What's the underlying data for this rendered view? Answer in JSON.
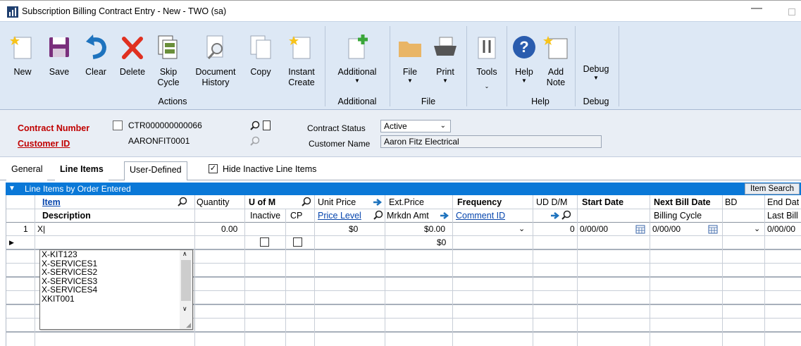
{
  "window": {
    "title": "Subscription Billing Contract Entry  -  New  -  TWO (sa)",
    "minimize": "—"
  },
  "ribbon": {
    "buttons": [
      {
        "label": "New"
      },
      {
        "label": "Save"
      },
      {
        "label": "Clear"
      },
      {
        "label": "Delete"
      },
      {
        "label": "Skip\nCycle"
      },
      {
        "label": "Document\nHistory"
      },
      {
        "label": "Copy"
      },
      {
        "label": "Instant\nCreate"
      },
      {
        "label": "Additional"
      },
      {
        "label": "File"
      },
      {
        "label": "Print"
      },
      {
        "label": "Tools"
      },
      {
        "label": "Help"
      },
      {
        "label": "Add\nNote"
      },
      {
        "label": "Debug"
      }
    ],
    "groups": [
      "Actions",
      "Additional",
      "File",
      "Help",
      "Debug"
    ],
    "accent": "#0a78d7"
  },
  "header": {
    "contract_number_label": "Contract Number",
    "contract_number": "CTR000000000066",
    "customer_id_label": "Customer ID",
    "customer_id": "AARONFIT0001",
    "contract_status_label": "Contract Status",
    "contract_status": "Active",
    "customer_name_label": "Customer Name",
    "customer_name": "Aaron Fitz Electrical"
  },
  "tabs": [
    "General",
    "Line Items",
    "User-Defined"
  ],
  "hide_inactive": {
    "label": "Hide Inactive Line Items",
    "checked": true
  },
  "grid": {
    "caption": "Line Items by Order Entered",
    "item_search": "Item Search",
    "headers_row1": {
      "item": "Item",
      "quantity": "Quantity",
      "uofm": "U of M",
      "unit_price": "Unit Price",
      "ext_price": "Ext.Price",
      "frequency": "Frequency",
      "ud_dm": "UD D/M",
      "start_date": "Start Date",
      "next_bill_date": "Next Bill Date",
      "bd": "BD",
      "end_date": "End Dat"
    },
    "headers_row2": {
      "description": "Description",
      "inactive": "Inactive",
      "cp": "CP",
      "price_level": "Price Level",
      "mrkdn_amt": "Mrkdn Amt",
      "comment_id": "Comment ID",
      "billing_cycle": "Billing Cycle",
      "last_bill": "Last Bill"
    },
    "row1": {
      "num": "1",
      "item": "X|",
      "quantity": "0.00",
      "unit_price": "$0",
      "ext_price": "$0.00",
      "ud": "0",
      "start_date": "0/00/00",
      "next_bill_date": "0/00/00",
      "end_date": "0/00/00"
    },
    "row2": {
      "ext_price": "$0"
    },
    "dropdown_options": [
      "X-KIT123",
      "X-SERVICES1",
      "X-SERVICES2",
      "X-SERVICES3",
      "X-SERVICES4",
      "XKIT001"
    ]
  }
}
